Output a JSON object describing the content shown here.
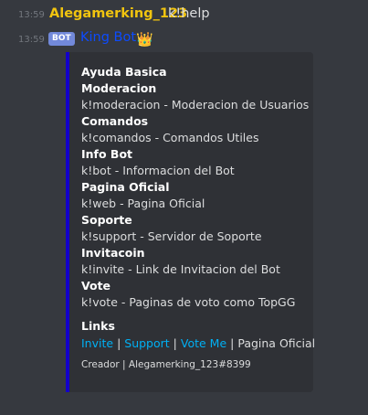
{
  "messages": {
    "user": {
      "time": "13:59",
      "author": "Alegamerking_123",
      "content": "k!help"
    },
    "bot": {
      "time": "13:59",
      "tag": "BOT",
      "author": "King Bot",
      "crown": "👑"
    }
  },
  "embed": {
    "accent_color": "#1300c9",
    "rows": [
      {
        "text": "Ayuda Basica",
        "bold": true
      },
      {
        "text": "Moderacion",
        "bold": true
      },
      {
        "text": "k!moderacion - Moderacion de Usuarios",
        "bold": false
      },
      {
        "text": "Comandos",
        "bold": true
      },
      {
        "text": "k!comandos - Comandos Utiles",
        "bold": false
      },
      {
        "text": "Info Bot",
        "bold": true
      },
      {
        "text": "k!bot - Informacion del Bot",
        "bold": false
      },
      {
        "text": "Pagina Oficial",
        "bold": true
      },
      {
        "text": "k!web - Pagina Oficial",
        "bold": false
      },
      {
        "text": "Soporte",
        "bold": true
      },
      {
        "text": "k!support - Servidor de Soporte",
        "bold": false
      },
      {
        "text": "Invitacoin",
        "bold": true
      },
      {
        "text": "k!invite - Link de Invitacion del Bot",
        "bold": false
      },
      {
        "text": "Vote",
        "bold": true
      },
      {
        "text": "k!vote - Paginas de voto como TopGG",
        "bold": false
      }
    ],
    "links_title": "Links",
    "links": {
      "invite": "Invite",
      "support": "Support",
      "vote": "Vote Me",
      "site": "Pagina Oficial",
      "separator": "|"
    },
    "footer": "Creador | Alegamerking_123#8399"
  }
}
